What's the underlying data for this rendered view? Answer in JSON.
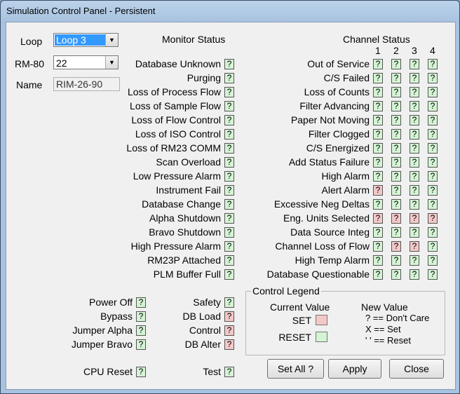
{
  "window": {
    "title": "Simulation Control Panel - Persistent"
  },
  "left": {
    "loop_label": "Loop",
    "loop_value": "Loop 3",
    "rm80_label": "RM-80",
    "rm80_value": "22",
    "name_label": "Name",
    "name_value": "RIM-26-90"
  },
  "monitor": {
    "title": "Monitor Status",
    "items": [
      {
        "label": "Database Unknown",
        "value": "?",
        "state": "green"
      },
      {
        "label": "Purging",
        "value": "?",
        "state": "green"
      },
      {
        "label": "Loss of Process Flow",
        "value": "?",
        "state": "green"
      },
      {
        "label": "Loss of Sample Flow",
        "value": "?",
        "state": "green"
      },
      {
        "label": "Loss of Flow Control",
        "value": "?",
        "state": "green"
      },
      {
        "label": "Loss of ISO Control",
        "value": "?",
        "state": "green"
      },
      {
        "label": "Loss of RM23 COMM",
        "value": "?",
        "state": "green"
      },
      {
        "label": "Scan Overload",
        "value": "?",
        "state": "green"
      },
      {
        "label": "Low Pressure Alarm",
        "value": "?",
        "state": "green"
      },
      {
        "label": "Instrument Fail",
        "value": "?",
        "state": "green"
      },
      {
        "label": "Database Change",
        "value": "?",
        "state": "green"
      },
      {
        "label": "Alpha Shutdown",
        "value": "?",
        "state": "green"
      },
      {
        "label": "Bravo Shutdown",
        "value": "?",
        "state": "green"
      },
      {
        "label": "High Pressure Alarm",
        "value": "?",
        "state": "green"
      },
      {
        "label": "RM23P Attached",
        "value": "?",
        "state": "green"
      },
      {
        "label": "PLM Buffer Full",
        "value": "?",
        "state": "green"
      }
    ]
  },
  "channel": {
    "title": "Channel Status",
    "columns": [
      "1",
      "2",
      "3",
      "4"
    ],
    "items": [
      {
        "label": "Out of Service",
        "values": [
          "?",
          "?",
          "?",
          "?"
        ],
        "states": [
          "green",
          "green",
          "green",
          "green"
        ]
      },
      {
        "label": "C/S Failed",
        "values": [
          "?",
          "?",
          "?",
          "?"
        ],
        "states": [
          "green",
          "green",
          "green",
          "green"
        ]
      },
      {
        "label": "Loss of Counts",
        "values": [
          "?",
          "?",
          "?",
          "?"
        ],
        "states": [
          "green",
          "green",
          "green",
          "green"
        ]
      },
      {
        "label": "Filter Advancing",
        "values": [
          "?",
          "?",
          "?",
          "?"
        ],
        "states": [
          "green",
          "green",
          "green",
          "green"
        ]
      },
      {
        "label": "Paper Not Moving",
        "values": [
          "?",
          "?",
          "?",
          "?"
        ],
        "states": [
          "green",
          "green",
          "green",
          "green"
        ]
      },
      {
        "label": "Filter Clogged",
        "values": [
          "?",
          "?",
          "?",
          "?"
        ],
        "states": [
          "green",
          "green",
          "green",
          "green"
        ]
      },
      {
        "label": "C/S Energized",
        "values": [
          "?",
          "?",
          "?",
          "?"
        ],
        "states": [
          "green",
          "green",
          "green",
          "green"
        ]
      },
      {
        "label": "Add Status Failure",
        "values": [
          "?",
          "?",
          "?",
          "?"
        ],
        "states": [
          "green",
          "green",
          "green",
          "green"
        ]
      },
      {
        "label": "High Alarm",
        "values": [
          "?",
          "?",
          "?",
          "?"
        ],
        "states": [
          "green",
          "green",
          "green",
          "green"
        ]
      },
      {
        "label": "Alert Alarm",
        "values": [
          "?",
          "?",
          "?",
          "?"
        ],
        "states": [
          "red",
          "green",
          "green",
          "green"
        ]
      },
      {
        "label": "Excessive Neg Deltas",
        "values": [
          "?",
          "?",
          "?",
          "?"
        ],
        "states": [
          "green",
          "green",
          "green",
          "green"
        ]
      },
      {
        "label": "Eng. Units Selected",
        "values": [
          "?",
          "?",
          "?",
          "?"
        ],
        "states": [
          "red",
          "red",
          "red",
          "red"
        ]
      },
      {
        "label": "Data Source Integ",
        "values": [
          "?",
          "?",
          "?",
          "?"
        ],
        "states": [
          "green",
          "green",
          "green",
          "green"
        ]
      },
      {
        "label": "Channel Loss of Flow",
        "values": [
          "?",
          "?",
          "?",
          "?"
        ],
        "states": [
          "green",
          "red",
          "red",
          "green"
        ]
      },
      {
        "label": "High Temp Alarm",
        "values": [
          "?",
          "?",
          "?",
          "?"
        ],
        "states": [
          "green",
          "green",
          "green",
          "green"
        ]
      },
      {
        "label": "Database Questionable",
        "values": [
          "?",
          "?",
          "?",
          "?"
        ],
        "states": [
          "green",
          "green",
          "green",
          "green"
        ]
      }
    ]
  },
  "bottom_left": [
    {
      "label": "Power Off",
      "value": "?",
      "state": "green"
    },
    {
      "label": "Bypass",
      "value": "?",
      "state": "green"
    },
    {
      "label": "Jumper Alpha",
      "value": "?",
      "state": "green"
    },
    {
      "label": "Jumper Bravo",
      "value": "?",
      "state": "green"
    }
  ],
  "bottom_mid": [
    {
      "label": "Safety",
      "value": "?",
      "state": "green"
    },
    {
      "label": "DB Load",
      "value": "?",
      "state": "red"
    },
    {
      "label": "Control",
      "value": "?",
      "state": "red"
    },
    {
      "label": "DB Alter",
      "value": "?",
      "state": "red"
    }
  ],
  "cpu_reset": {
    "label": "CPU Reset",
    "value": "?",
    "state": "green"
  },
  "test": {
    "label": "Test",
    "value": "?",
    "state": "green"
  },
  "legend": {
    "title": "Control Legend",
    "current_value_label": "Current Value",
    "set_label": "SET",
    "reset_label": "RESET",
    "new_value_label": "New Value",
    "dont_care": "? == Don't Care",
    "x_set": "X == Set",
    "reset_desc": "' ' == Reset"
  },
  "buttons": {
    "set_all": "Set All ?",
    "apply": "Apply",
    "close": "Close"
  },
  "colors": {
    "green": "#d4f4d4",
    "red": "#f4c8c8",
    "selection": "#3399ff"
  }
}
